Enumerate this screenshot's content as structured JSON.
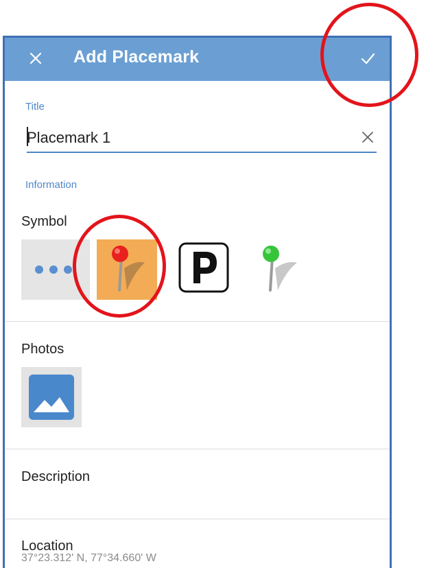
{
  "appbar": {
    "title": "Add Placemark",
    "close_icon": "close-icon",
    "confirm_icon": "checkmark-icon"
  },
  "form": {
    "title_label": "Title",
    "title_value": "Placemark 1",
    "clear_icon": "clear-icon",
    "information_label": "Information"
  },
  "symbol": {
    "label": "Symbol",
    "options": [
      {
        "name": "more-symbols",
        "icon": "ellipsis-icon"
      },
      {
        "name": "red-pin",
        "icon": "red-pushpin-icon",
        "selected": true
      },
      {
        "name": "parking",
        "text": "P"
      },
      {
        "name": "green-pin",
        "icon": "green-pushpin-icon"
      }
    ]
  },
  "photos": {
    "label": "Photos",
    "add_icon": "image-placeholder-icon"
  },
  "description": {
    "label": "Description"
  },
  "location": {
    "label": "Location",
    "value": "37°23.312' N, 77°34.660' W"
  },
  "colors": {
    "appbar": "#6b9fd3",
    "accent": "#4f86c6",
    "frame": "#3f6fb6",
    "selected_symbol_bg": "#f3ac55",
    "annotation": "#e3141b"
  }
}
